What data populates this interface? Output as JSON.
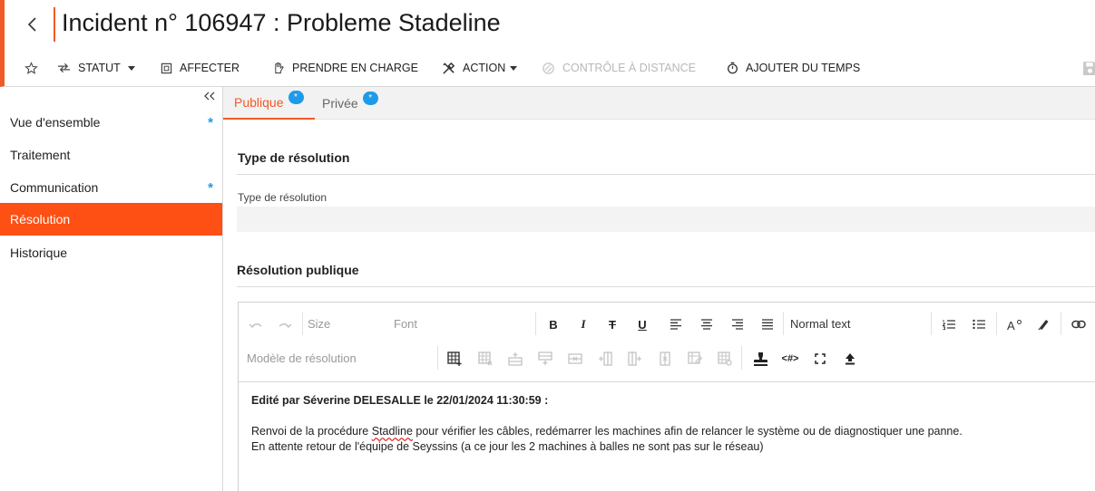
{
  "header": {
    "title": "Incident n° 106947 : Probleme Stadeline"
  },
  "toolbar": {
    "statut": "STATUT",
    "affecter": "AFFECTER",
    "prendre_en_charge": "PRENDRE EN CHARGE",
    "action": "ACTION",
    "controle_distance": "CONTRÔLE À DISTANCE",
    "ajouter_temps": "AJOUTER DU TEMPS"
  },
  "sidebar": {
    "items": [
      {
        "label": "Vue d'ensemble",
        "star": "*"
      },
      {
        "label": "Traitement"
      },
      {
        "label": "Communication",
        "star": "*"
      },
      {
        "label": "Résolution"
      },
      {
        "label": "Historique"
      }
    ]
  },
  "tabs": [
    {
      "label": "Publique",
      "badge": "*"
    },
    {
      "label": "Privée",
      "badge": "*"
    }
  ],
  "resolution_type": {
    "section_title": "Type de résolution",
    "field_label": "Type de résolution",
    "value": ""
  },
  "public_resolution": {
    "section_title": "Résolution publique",
    "editor": {
      "size_label": "Size",
      "font_label": "Font",
      "format_label": "Normal text",
      "template_label": "Modèle de résolution",
      "code_label": "<#>",
      "content": {
        "header_line": "Edité par Séverine DELESALLE le 22/01/2024 11:30:59 :",
        "line1_before": "Renvoi de la procédure ",
        "line1_misspelled": "Stadline",
        "line1_after": " pour vérifier les câbles, redémarrer les machines afin de relancer le système ou de diagnostiquer une panne.",
        "line2": "En attente retour de l'équipe de Seyssins (a ce jour les 2 machines à balles ne sont pas sur le réseau)"
      }
    }
  },
  "colors": {
    "accent": "#f05a28",
    "active_nav": "#fe4f14",
    "badge": "#1e9be8"
  }
}
